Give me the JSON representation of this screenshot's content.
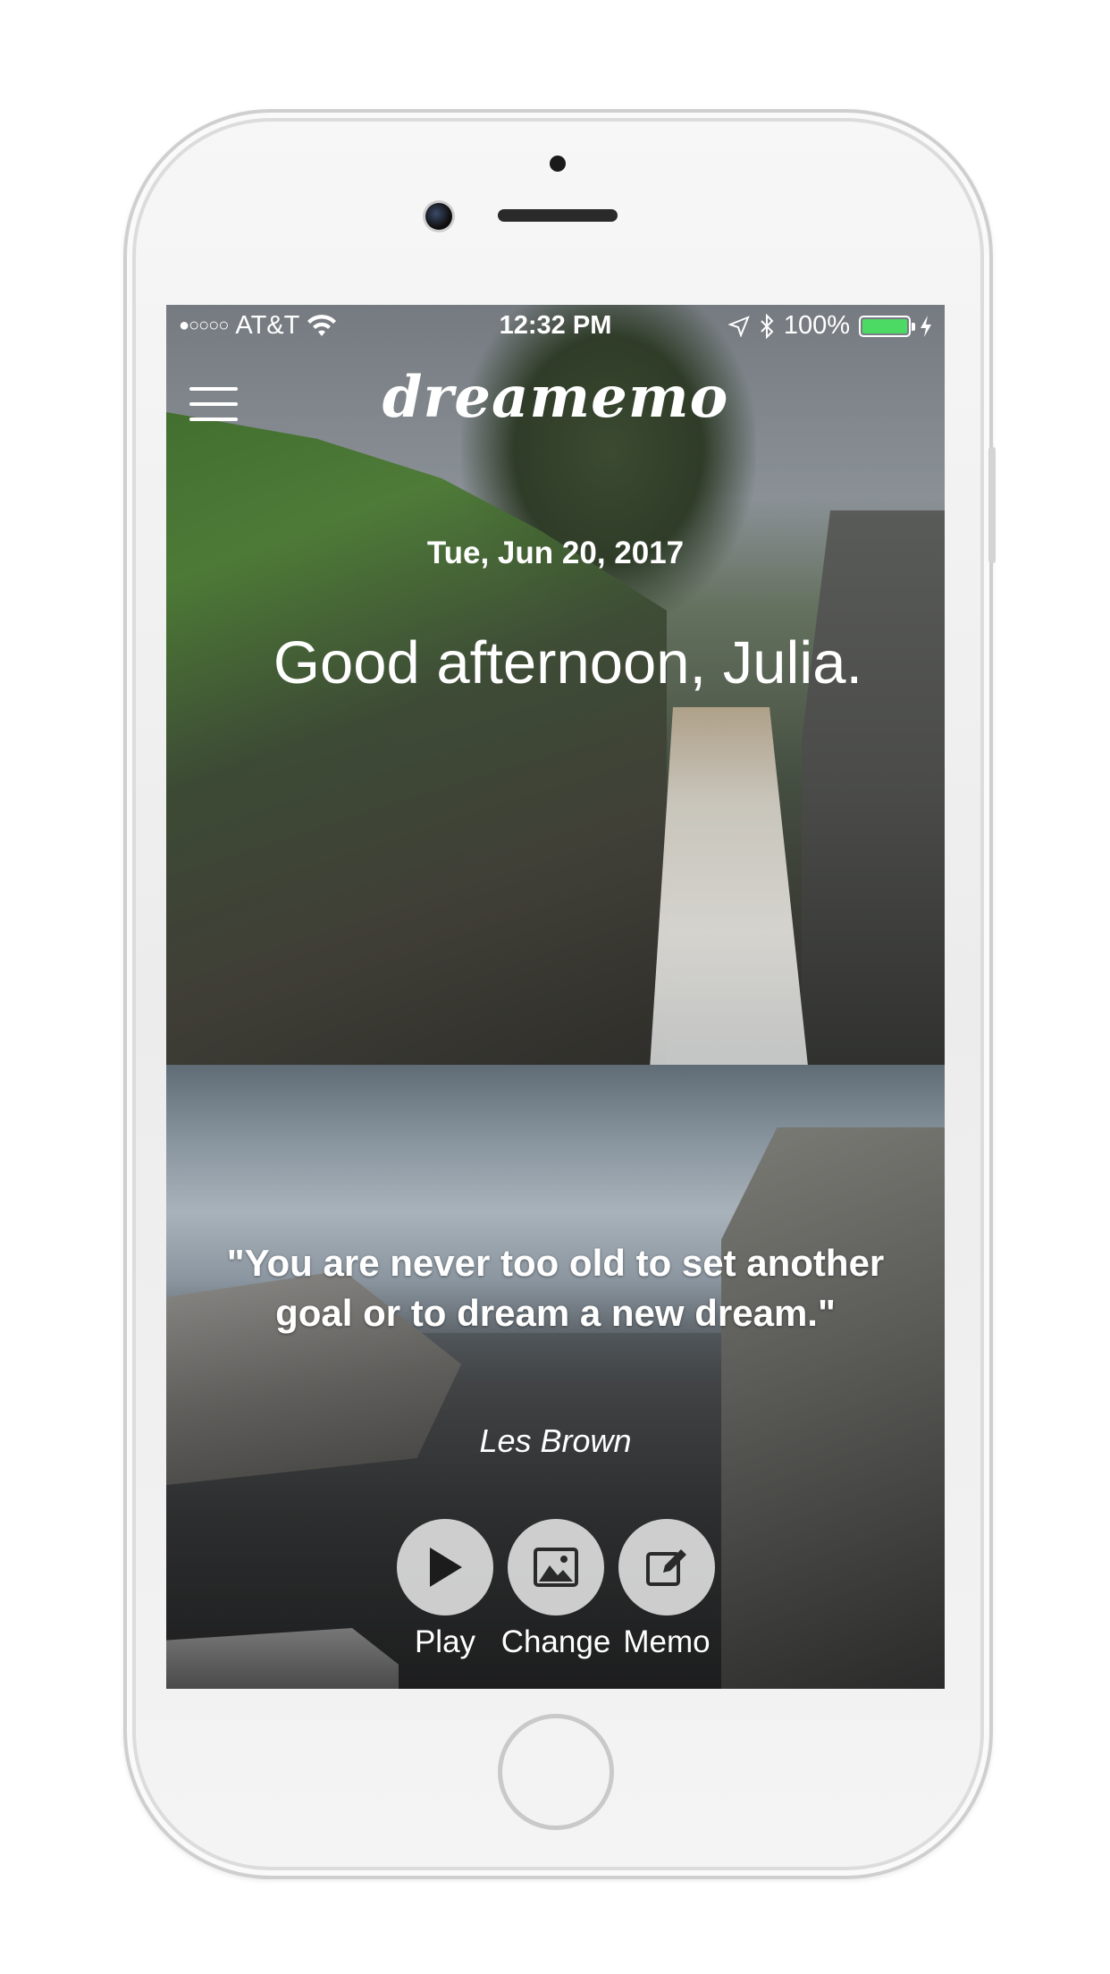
{
  "status_bar": {
    "signal": "●○○○○",
    "carrier": "AT&T",
    "time": "12:32 PM",
    "battery_percent": "100%",
    "battery_level": 1.0,
    "battery_color": "#4cd964"
  },
  "header": {
    "logo": "dreamemo",
    "menu_icon": "hamburger-menu-icon"
  },
  "main": {
    "date": "Tue, Jun 20, 2017",
    "greeting": "Good afternoon, Julia.",
    "quote": "\"You are never too old to set another goal or to dream a new dream.\"",
    "author": "Les Brown"
  },
  "actions": [
    {
      "label": "Play",
      "icon": "play-icon"
    },
    {
      "label": "Change",
      "icon": "image-icon"
    },
    {
      "label": "Memo",
      "icon": "edit-icon"
    }
  ]
}
